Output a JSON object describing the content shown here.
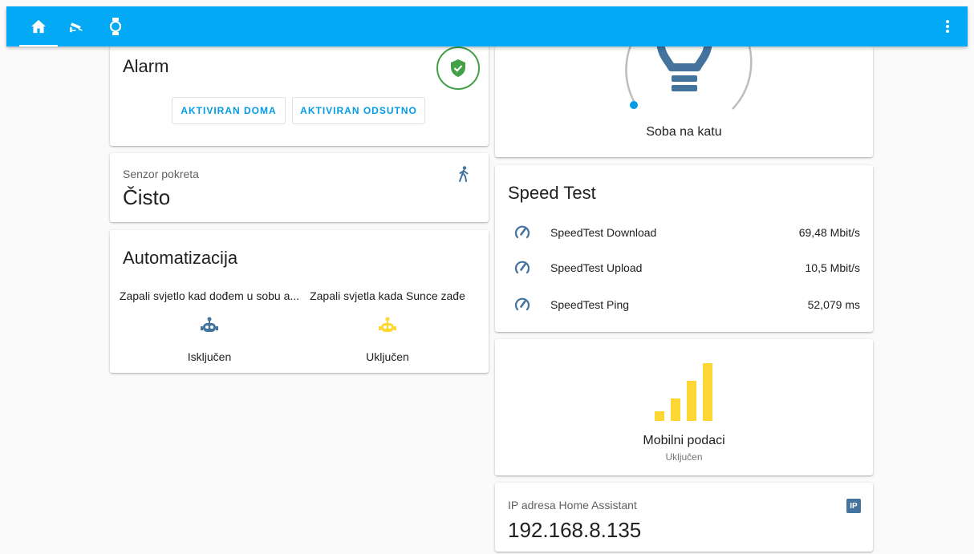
{
  "toolbar": {
    "tabs": [
      {
        "icon": "home-icon",
        "active": true
      },
      {
        "icon": "cctv-camera-icon",
        "active": false
      },
      {
        "icon": "watch-icon",
        "active": false
      }
    ],
    "menu_icon": "dots-vertical-icon",
    "color": "#03a9f4"
  },
  "alarm": {
    "title": "Alarm",
    "status_icon": "shield-check-icon",
    "status_color": "#43a047",
    "buttons": [
      "AKTIVIRAN DOMA",
      "AKTIVIRAN ODSUTNO"
    ]
  },
  "motion_sensor": {
    "name": "Senzor pokreta",
    "state": "Čisto",
    "icon": "walk-icon"
  },
  "automations": {
    "title": "Automatizacija",
    "items": [
      {
        "name": "Zapali svjetlo kad dođem u sobu a...",
        "state": "Isključen",
        "icon": "robot-icon",
        "color": "#44739e"
      },
      {
        "name": "Zapali svjetla kada Sunce zađe",
        "state": "Uključen",
        "icon": "robot-icon",
        "color": "#fdd835"
      }
    ]
  },
  "light": {
    "name": "Soba na katu",
    "icon": "lightbulb-icon",
    "color": "#44739e"
  },
  "speed_test": {
    "title": "Speed Test",
    "rows": [
      {
        "label": "SpeedTest Download",
        "value": "69,48 Mbit/s",
        "icon": "speedometer-icon"
      },
      {
        "label": "SpeedTest Upload",
        "value": "10,5 Mbit/s",
        "icon": "speedometer-icon"
      },
      {
        "label": "SpeedTest Ping",
        "value": "52,079 ms",
        "icon": "speedometer-icon"
      }
    ]
  },
  "mobile_data": {
    "name": "Mobilni podaci",
    "state": "Uključen",
    "icon": "signal-bars-icon",
    "color": "#fdd835"
  },
  "ip": {
    "name": "IP adresa Home Assistant",
    "value": "192.168.8.135",
    "badge": "IP"
  }
}
